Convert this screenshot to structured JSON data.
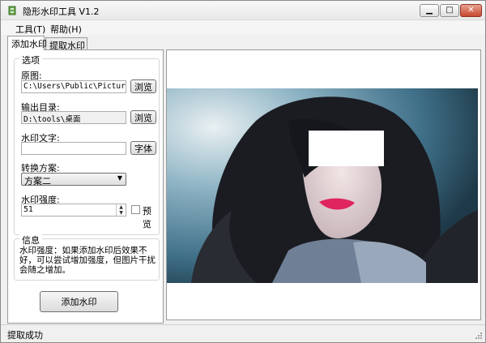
{
  "window": {
    "title": "隐形水印工具 V1.2"
  },
  "menu": {
    "tools": "工具(T)",
    "help": "帮助(H)"
  },
  "tabs": [
    {
      "label": "添加水印"
    },
    {
      "label": "提取水印"
    }
  ],
  "options": {
    "legend": "选项",
    "source": {
      "label": "原图:",
      "value": "C:\\Users\\Public\\Pictures\\Sa",
      "browse": "浏览"
    },
    "output": {
      "label": "输出目录:",
      "value": "D:\\tools\\桌面",
      "browse": "浏览"
    },
    "text": {
      "label": "水印文字:",
      "value": "",
      "font_button": "字体"
    },
    "scheme": {
      "label": "转换方案:",
      "selected": "方案二"
    },
    "strength": {
      "label": "水印强度:",
      "value": "51",
      "preview_label": "预览"
    }
  },
  "info": {
    "legend": "信息",
    "text": "水印强度：如果添加水印后效果不好，可以尝试增加强度，但图片干扰会随之增加。"
  },
  "actions": {
    "add": "添加水印"
  },
  "status": {
    "text": "提取成功"
  },
  "colors": {
    "accent_close": "#c7472d",
    "lips": "#e0245e",
    "photo_bg": "#3f6f88"
  }
}
